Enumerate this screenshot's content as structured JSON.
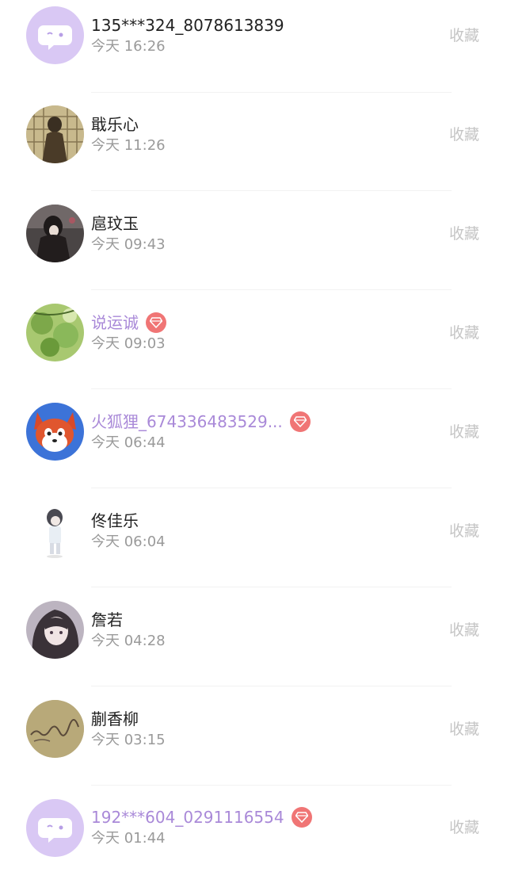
{
  "items": [
    {
      "name": "135***324_8078613839",
      "time": "今天 16:26",
      "action": "收藏",
      "vip": false,
      "avatar": "bubble-avatar-icon"
    },
    {
      "name": "戢乐心",
      "time": "今天 11:26",
      "action": "收藏",
      "vip": false,
      "avatar": "user-avatar"
    },
    {
      "name": "扈玟玉",
      "time": "今天 09:43",
      "action": "收藏",
      "vip": false,
      "avatar": "user-avatar"
    },
    {
      "name": "说运诚",
      "time": "今天 09:03",
      "action": "收藏",
      "vip": true,
      "avatar": "user-avatar"
    },
    {
      "name": "火狐狸_674336483529...",
      "time": "今天 06:44",
      "action": "收藏",
      "vip": true,
      "avatar": "fox-avatar"
    },
    {
      "name": "佟佳乐",
      "time": "今天 06:04",
      "action": "收藏",
      "vip": false,
      "avatar": "user-avatar"
    },
    {
      "name": "詹若",
      "time": "今天 04:28",
      "action": "收藏",
      "vip": false,
      "avatar": "user-avatar"
    },
    {
      "name": "蒯香柳",
      "time": "今天 03:15",
      "action": "收藏",
      "vip": false,
      "avatar": "user-avatar"
    },
    {
      "name": "192***604_0291116554",
      "time": "今天 01:44",
      "action": "收藏",
      "vip": true,
      "avatar": "bubble-avatar-icon"
    }
  ],
  "colors": {
    "vip_name": "#a989d8",
    "vip_badge": "#f07575",
    "avatar_bubble_bg": "#d9c8f4",
    "action_text": "#c5c5c5",
    "time_text": "#9a9a9a"
  }
}
